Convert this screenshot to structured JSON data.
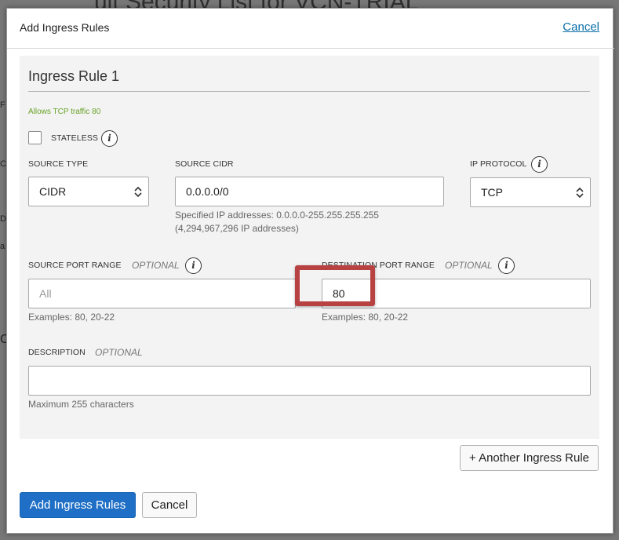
{
  "background": {
    "title_fragment": "ult Security List for VCN-TRIAL",
    "edge_letters": [
      "F",
      "C",
      "D",
      "a",
      "C"
    ]
  },
  "dialog": {
    "title": "Add Ingress Rules",
    "cancel_link": "Cancel"
  },
  "rule": {
    "heading": "Ingress Rule 1",
    "summary": "Allows TCP traffic 80",
    "stateless_label": "STATELESS",
    "stateless_checked": false,
    "source_type": {
      "label": "SOURCE TYPE",
      "value": "CIDR"
    },
    "source_cidr": {
      "label": "SOURCE CIDR",
      "value": "0.0.0.0/0",
      "help_line1": "Specified IP addresses: 0.0.0.0-255.255.255.255",
      "help_line2": "(4,294,967,296 IP addresses)"
    },
    "ip_protocol": {
      "label": "IP PROTOCOL",
      "value": "TCP"
    },
    "source_port_range": {
      "label": "SOURCE PORT RANGE",
      "optional": "OPTIONAL",
      "placeholder": "All",
      "value": "",
      "examples": "Examples: 80, 20-22"
    },
    "destination_port_range": {
      "label": "DESTINATION PORT RANGE",
      "optional": "OPTIONAL",
      "value": "80",
      "examples": "Examples: 80, 20-22"
    },
    "description": {
      "label": "DESCRIPTION",
      "optional": "OPTIONAL",
      "value": "",
      "hint": "Maximum 255 characters"
    }
  },
  "buttons": {
    "another_rule": "+ Another Ingress Rule",
    "add_rules": "Add Ingress Rules",
    "cancel": "Cancel"
  },
  "icons": {
    "info": "info-icon",
    "select_arrows": "chevron-up-down-icon"
  },
  "colors": {
    "primary_button": "#1e6fc5",
    "link": "#0b6ea8",
    "summary_text": "#6aa32a",
    "highlight_box": "#b84242"
  }
}
